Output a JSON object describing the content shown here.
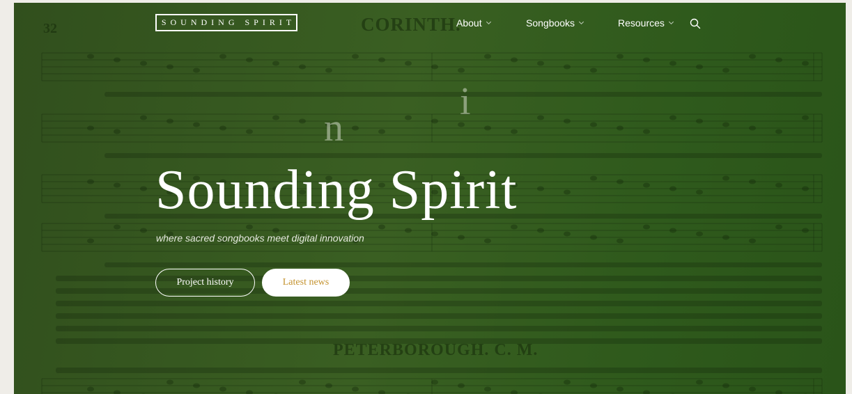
{
  "nav": {
    "logo": "SOUNDING SPIRIT",
    "items": [
      {
        "label": "About"
      },
      {
        "label": "Songbooks"
      },
      {
        "label": "Resources"
      }
    ],
    "search_icon": "search-icon"
  },
  "hero": {
    "title": "Sounding Spirit",
    "tagline": "where sacred songbooks meet digital innovation",
    "buttons": {
      "history": "Project history",
      "news": "Latest news"
    }
  },
  "background": {
    "page_number": "32",
    "hymn_one": "CORINTH.",
    "hymn_two": "PETERBOROUGH.  C. M.",
    "letter_n": "n",
    "letter_i": "i"
  },
  "colors": {
    "overlay": "#3a5f22",
    "news_text": "#c4922e",
    "page": "#efede8"
  }
}
